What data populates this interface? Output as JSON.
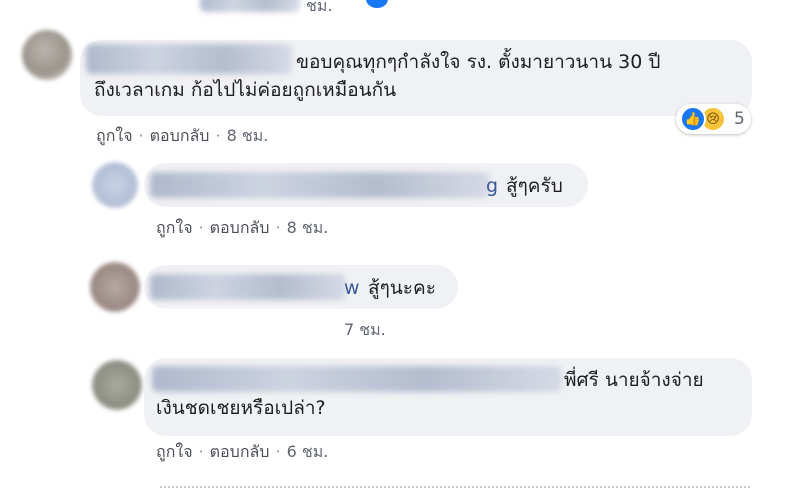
{
  "comments": [
    {
      "text_line1": "ขอบคุณทุกๆกำลังใจ รง. ตั้งมายาวนาน 30 ปี",
      "text_line2": "ถึงเวลาเกม ก้อไปไม่ค่อยถูกเหมือนกัน",
      "like": "ถูกใจ",
      "reply": "ตอบกลับ",
      "time": "8 ชม.",
      "reactions": {
        "icons": [
          "like-icon",
          "sad-icon"
        ],
        "count": "5"
      }
    },
    {
      "name_tail": "g",
      "text_line1": "สู้ๆครับ",
      "like": "ถูกใจ",
      "reply": "ตอบกลับ",
      "time": "8 ชม."
    },
    {
      "name_tail": "w",
      "text_line1": "สู้ๆนะคะ",
      "time_partial": "7 ชม."
    },
    {
      "text_line1": "พี่ศรี นายจ้างจ่าย",
      "text_line2": "เงินชดเชยหรือเปล่า?",
      "like": "ถูกใจ",
      "reply": "ตอบกลับ",
      "time": "6 ชม."
    }
  ],
  "top_partial": {
    "time": "ชม."
  },
  "colors": {
    "bubble": "#f0f1f4",
    "link": "#385898",
    "meta": "#606770",
    "like_blue": "#1877f2"
  }
}
